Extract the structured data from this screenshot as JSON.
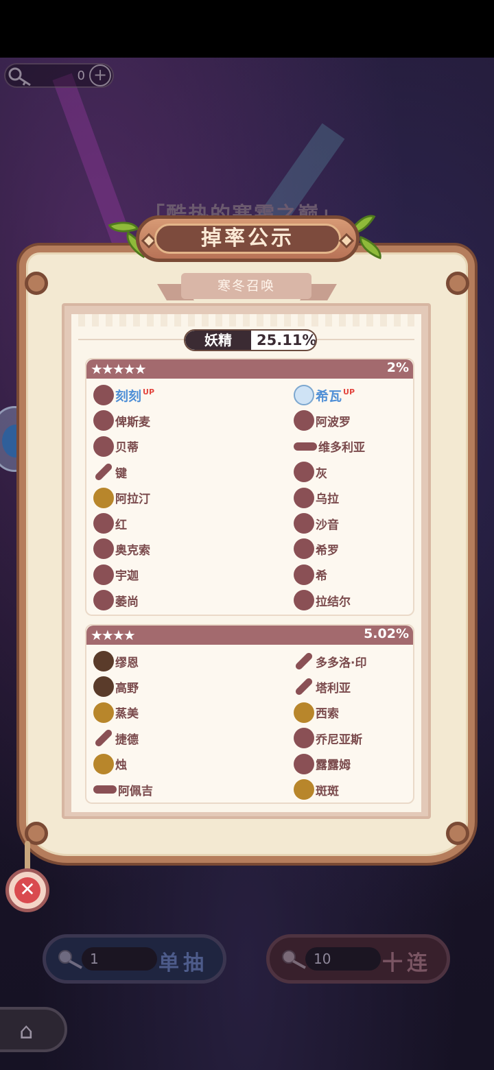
{
  "background_title": "「酷热的寒霜之巅」",
  "key_counter": {
    "value": "0",
    "plus": "+"
  },
  "dialog": {
    "title": "掉率公示",
    "subtitle": "寒冬召唤",
    "category": {
      "label": "妖精",
      "rate": "25.11%"
    },
    "sections": [
      {
        "stars": "★★★★★",
        "rate": "2%",
        "items": [
          {
            "name": "刻刻",
            "up": "UP",
            "highlight": true,
            "icon": "bomb-icon"
          },
          {
            "name": "希瓦",
            "up": "UP",
            "highlight": true,
            "icon": "cloud-icon"
          },
          {
            "name": "俾斯麦",
            "up": "",
            "highlight": false,
            "icon": "blob-icon"
          },
          {
            "name": "阿波罗",
            "up": "",
            "highlight": false,
            "icon": "egg-icon"
          },
          {
            "name": "贝蒂",
            "up": "",
            "highlight": false,
            "icon": "scissors-icon"
          },
          {
            "name": "维多利亚",
            "up": "",
            "highlight": false,
            "icon": "plate-icon"
          },
          {
            "name": "键",
            "up": "",
            "highlight": false,
            "icon": "stick-icon"
          },
          {
            "name": "灰",
            "up": "",
            "highlight": false,
            "icon": "doll-icon"
          },
          {
            "name": "阿拉汀",
            "up": "",
            "highlight": false,
            "icon": "lamp-icon"
          },
          {
            "name": "乌拉",
            "up": "",
            "highlight": false,
            "icon": "bottle-icon"
          },
          {
            "name": "红",
            "up": "",
            "highlight": false,
            "icon": "basket-icon"
          },
          {
            "name": "沙音",
            "up": "",
            "highlight": false,
            "icon": "cage-icon"
          },
          {
            "name": "奥克索",
            "up": "",
            "highlight": false,
            "icon": "dragon-icon"
          },
          {
            "name": "希罗",
            "up": "",
            "highlight": false,
            "icon": "crown-icon"
          },
          {
            "name": "宇迦",
            "up": "",
            "highlight": false,
            "icon": "rice-icon"
          },
          {
            "name": "希",
            "up": "",
            "highlight": false,
            "icon": "key-icon"
          },
          {
            "name": "萎尚",
            "up": "",
            "highlight": false,
            "icon": "ball-icon"
          },
          {
            "name": "拉结尔",
            "up": "",
            "highlight": false,
            "icon": "drumstick-icon"
          }
        ]
      },
      {
        "stars": "★★★★",
        "rate": "5.02%",
        "items": [
          {
            "name": "缪恩",
            "up": "",
            "highlight": false,
            "icon": "chess-king-icon"
          },
          {
            "name": "多多洛·印",
            "up": "",
            "highlight": false,
            "icon": "pipe-icon"
          },
          {
            "name": "高野",
            "up": "",
            "highlight": false,
            "icon": "hammer-icon"
          },
          {
            "name": "塔利亚",
            "up": "",
            "highlight": false,
            "icon": "knife-icon"
          },
          {
            "name": "蒸美",
            "up": "",
            "highlight": false,
            "icon": "steamer-icon"
          },
          {
            "name": "西索",
            "up": "",
            "highlight": false,
            "icon": "ring-icon"
          },
          {
            "name": "捷德",
            "up": "",
            "highlight": false,
            "icon": "needle-icon"
          },
          {
            "name": "乔尼亚斯",
            "up": "",
            "highlight": false,
            "icon": "flower-icon"
          },
          {
            "name": "烛",
            "up": "",
            "highlight": false,
            "icon": "candle-icon"
          },
          {
            "name": "露露姆",
            "up": "",
            "highlight": false,
            "icon": "vial-icon"
          },
          {
            "name": "阿佩吉",
            "up": "",
            "highlight": false,
            "icon": "glasses-icon"
          },
          {
            "name": "斑斑",
            "up": "",
            "highlight": false,
            "icon": "bread-icon"
          }
        ]
      }
    ],
    "close_symbol": "✕"
  },
  "buttons": {
    "single": {
      "count": "1",
      "label": "单抽"
    },
    "ten": {
      "count": "10",
      "label": "十连"
    }
  },
  "home_symbol": "⌂"
}
